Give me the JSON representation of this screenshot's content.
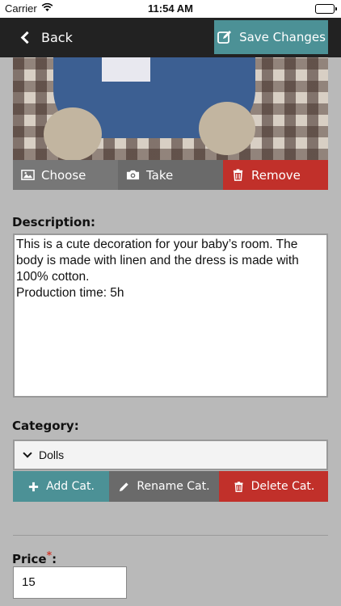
{
  "status_bar": {
    "carrier": "Carrier",
    "time": "11:54 AM"
  },
  "nav": {
    "back_label": "Back",
    "save_label": "Save Changes"
  },
  "photo_actions": {
    "choose": "Choose",
    "take": "Take",
    "remove": "Remove"
  },
  "description": {
    "label": "Description:",
    "value": "This is a cute decoration for your baby’s room. The body is made with linen and the dress is made with 100% cotton.\nProduction time: 5h"
  },
  "category": {
    "label": "Category:",
    "selected": "Dolls",
    "add": "Add Cat.",
    "rename": "Rename Cat.",
    "delete": "Delete Cat."
  },
  "price": {
    "label": "Price",
    "required_mark": "*",
    "label_suffix": ":",
    "value": "15"
  },
  "colors": {
    "accent": "#4c9196",
    "danger": "#c1302a",
    "neutral": "#6a6a6a",
    "background": "#b9b9b9",
    "navbar": "#222222"
  }
}
